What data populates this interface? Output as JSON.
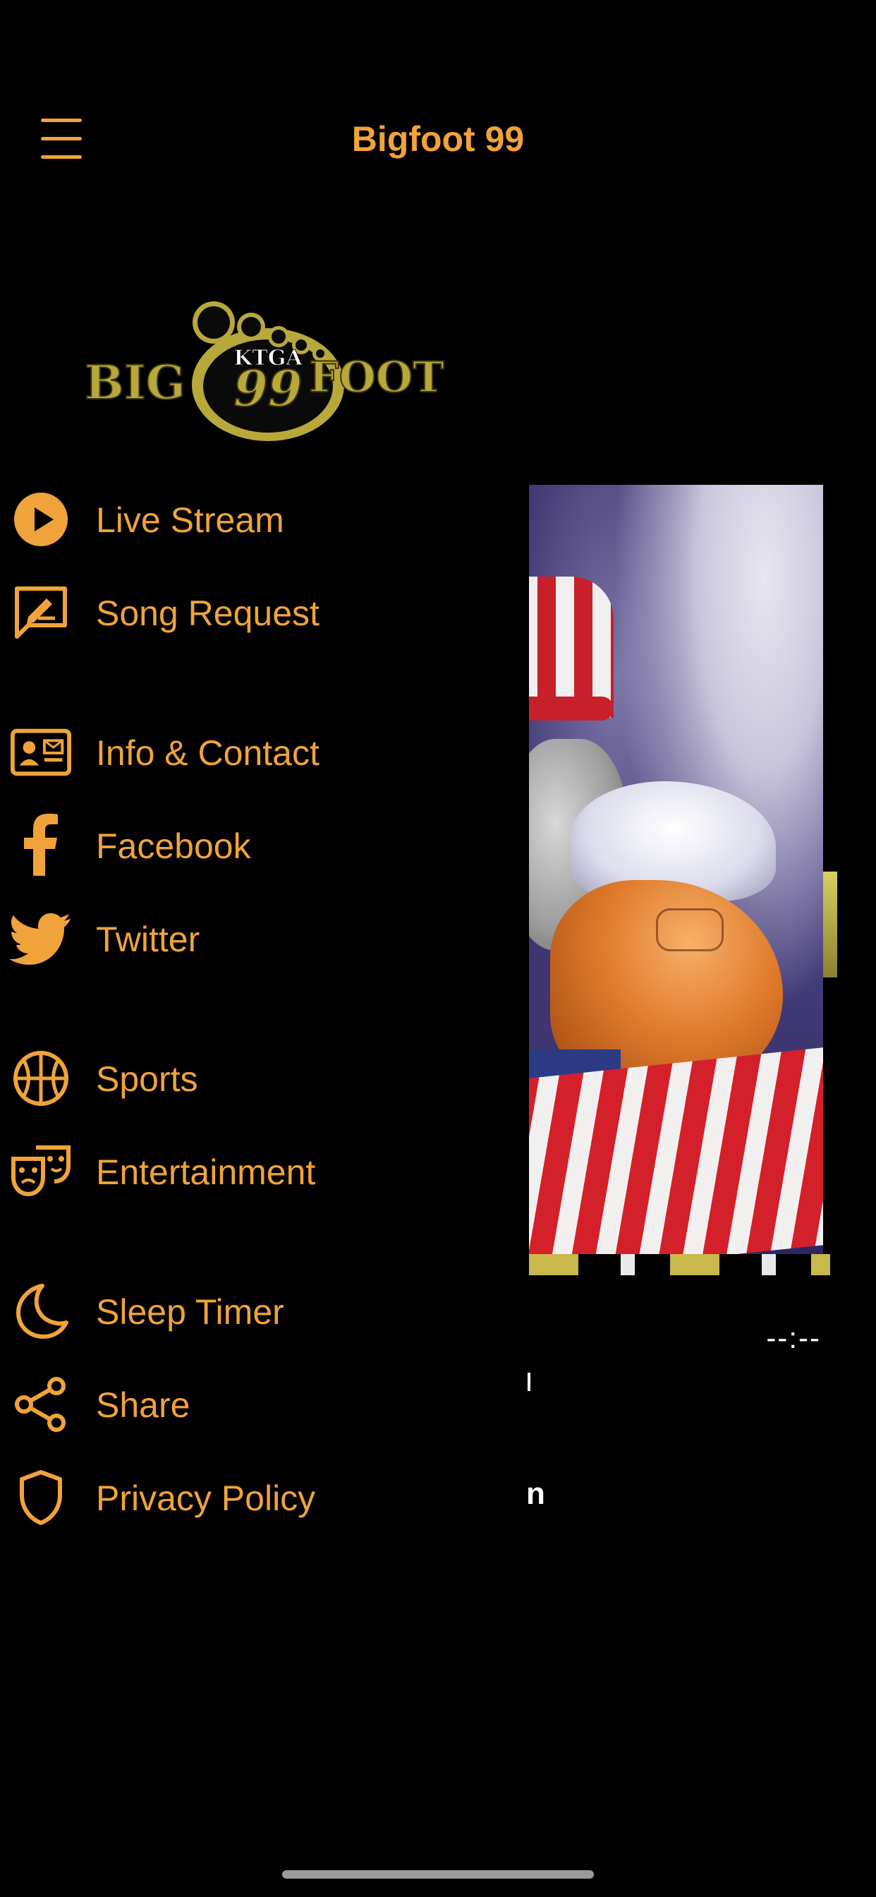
{
  "header": {
    "title": "Bigfoot 99",
    "menu_icon": "hamburger-icon"
  },
  "logo": {
    "top_text": "KTGA",
    "left_text": "BIG",
    "center_text": "99",
    "right_text": "FOOT"
  },
  "menu": {
    "items": [
      {
        "label": "Live Stream",
        "icon": "play-circle-icon"
      },
      {
        "label": "Song Request",
        "icon": "message-edit-icon"
      },
      {
        "label": "Info & Contact",
        "icon": "contact-card-icon"
      },
      {
        "label": "Facebook",
        "icon": "facebook-icon"
      },
      {
        "label": "Twitter",
        "icon": "twitter-icon"
      },
      {
        "label": "Sports",
        "icon": "basketball-icon"
      },
      {
        "label": "Entertainment",
        "icon": "theater-masks-icon"
      },
      {
        "label": "Sleep Timer",
        "icon": "moon-icon"
      },
      {
        "label": "Share",
        "icon": "share-icon"
      },
      {
        "label": "Privacy Policy",
        "icon": "shield-icon"
      }
    ]
  },
  "player": {
    "time": "--:--",
    "partial_title": "n"
  },
  "colors": {
    "accent": "#f0a33a",
    "background": "#000000",
    "logo_gold": "#b8a83a"
  }
}
